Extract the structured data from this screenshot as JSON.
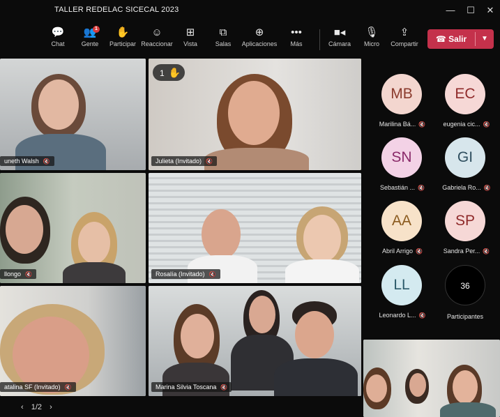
{
  "window": {
    "title": "TALLER REDELAC SICECAL 2023"
  },
  "toolbar": {
    "items": [
      {
        "label": "Chat",
        "icon": "chat-icon"
      },
      {
        "label": "Gente",
        "icon": "people-icon",
        "badge": "1"
      },
      {
        "label": "Participar",
        "icon": "raise-hand-icon"
      },
      {
        "label": "Reaccionar",
        "icon": "smile-icon"
      },
      {
        "label": "Vista",
        "icon": "grid-icon"
      },
      {
        "label": "Salas",
        "icon": "rooms-icon"
      },
      {
        "label": "Aplicaciones",
        "icon": "apps-icon"
      },
      {
        "label": "Más",
        "icon": "more-icon"
      },
      {
        "label": "Cámara",
        "icon": "camera-icon"
      },
      {
        "label": "Micro",
        "icon": "mic-icon"
      },
      {
        "label": "Compartir",
        "icon": "share-icon"
      }
    ],
    "leave_label": "Salir"
  },
  "tiles": [
    {
      "name": "uneth Walsh"
    },
    {
      "name": "Julieta (Invitado)",
      "hand_count": "1"
    },
    {
      "name": "llongo"
    },
    {
      "name": "Rosalía (Invitado)"
    },
    {
      "name": "atalina SF (Invitado)"
    },
    {
      "name": "Marina Silvia Toscana"
    }
  ],
  "participants": [
    {
      "initials": "MB",
      "name": "Marilina Bá...",
      "bg": "#f3d6cf",
      "fg": "#8a3a2c"
    },
    {
      "initials": "EC",
      "name": "eugenia cic...",
      "bg": "#f6d8d6",
      "fg": "#8f2a2a"
    },
    {
      "initials": "SN",
      "name": "Sebastián ...",
      "bg": "#f3d2e6",
      "fg": "#8a2a6a"
    },
    {
      "initials": "GI",
      "name": "Gabriela Ro...",
      "bg": "#d7e6ec",
      "fg": "#2f4f5f"
    },
    {
      "initials": "AA",
      "name": "Abril Arrigo",
      "bg": "#f7e2c9",
      "fg": "#8a5a1e"
    },
    {
      "initials": "SP",
      "name": "Sandra Per...",
      "bg": "#f6d8d6",
      "fg": "#8f2a2a"
    },
    {
      "initials": "LL",
      "name": "Leonardo L...",
      "bg": "#d4eaf0",
      "fg": "#2c5a6a"
    }
  ],
  "participants_more": {
    "count": "36",
    "label": "Participantes"
  },
  "pager": {
    "text": "1/2"
  }
}
